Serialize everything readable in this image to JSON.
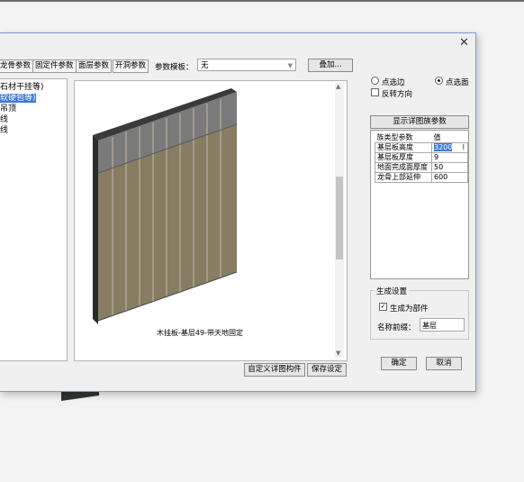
{
  "tabs": [
    "龙骨参数",
    "固定件参数",
    "面层参数",
    "开洞参数"
  ],
  "template_label": "参数模板：",
  "template_value": "无",
  "stack_button": "叠加...",
  "tree_items": [
    "石材干挂等)",
    "软硬包等)",
    "吊顶",
    "线",
    "线"
  ],
  "preview_caption": "木挂板-基层49-带天地固定",
  "custom_button": "自定义详图构件",
  "save_button": "保存设定",
  "radio_edge": "点选边",
  "radio_face": "点选面",
  "reverse_label": "反转方向",
  "show_params_button": "显示详图族参数",
  "param_grid": {
    "col_name": "族类型参数",
    "col_value": "值",
    "rows": [
      {
        "name": "基层板高度",
        "value": "3200"
      },
      {
        "name": "基层板厚度",
        "value": "9"
      },
      {
        "name": "地面完成面厚度",
        "value": "50"
      },
      {
        "name": "龙骨上部延伸",
        "value": "600"
      }
    ]
  },
  "gen_settings_title": "生成设置",
  "gen_as_part_label": "生成为部件",
  "name_prefix_label": "名称前缀：",
  "name_prefix_value": "基层",
  "ok_button": "确定",
  "cancel_button": "取消",
  "close_glyph": "✕"
}
